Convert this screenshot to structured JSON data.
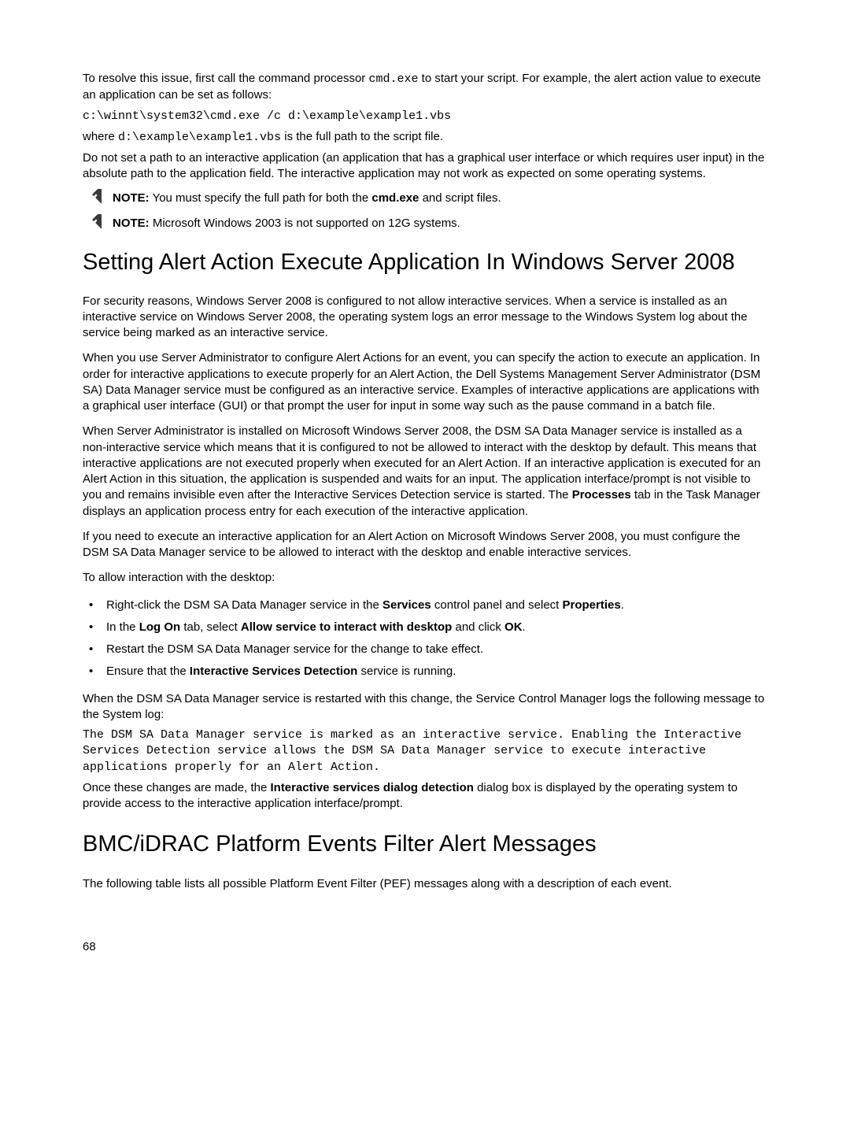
{
  "intro": {
    "p1a": "To resolve this issue, first call the command processor ",
    "p1_cmd": "cmd.exe",
    "p1b": " to start your script. For example, the alert action value to execute an application can be set as follows:",
    "code1": "c:\\winnt\\system32\\cmd.exe /c d:\\example\\example1.vbs",
    "p2a": "where ",
    "p2_code": "d:\\example\\example1.vbs",
    "p2b": " is the full path to the script file.",
    "p3": "Do not set a path to an interactive application (an application that has a graphical user interface or which requires user input) in the absolute path to the application field. The interactive application may not work as expected on some operating systems."
  },
  "note1": {
    "label": "NOTE:",
    "text_a": " You must specify the full path for both the ",
    "bold": "cmd.exe",
    "text_b": " and script files."
  },
  "note2": {
    "label": "NOTE:",
    "text": " Microsoft Windows 2003 is not supported on 12G systems."
  },
  "heading1": "Setting Alert Action Execute Application In Windows Server 2008",
  "section1": {
    "p1": "For security reasons, Windows Server 2008 is configured to not allow interactive services. When a service is installed as an interactive service on Windows Server 2008, the operating system logs an error message to the Windows System log about the service being marked as an interactive service.",
    "p2": "When you use Server Administrator to configure Alert Actions for an event, you can specify the action to execute an application. In order for interactive applications to execute properly for an Alert Action, the Dell Systems Management Server Administrator (DSM SA) Data Manager service must be configured as an interactive service. Examples of interactive applications are applications with a graphical user interface (GUI) or that prompt the user for input in some way such as the pause command in a batch file.",
    "p3a": "When Server Administrator is installed on Microsoft Windows Server 2008, the DSM SA Data Manager service is installed as a non-interactive service which means that it is configured to not be allowed to interact with the desktop by default. This means that interactive applications are not executed properly when executed for an Alert Action. If an interactive application is executed for an Alert Action in this situation, the application is suspended and waits for an input. The application interface/prompt is not visible to you and remains invisible even after the Interactive Services Detection service is started. The ",
    "p3_bold": "Processes",
    "p3b": " tab in the Task Manager displays an application process entry for each execution of the interactive application.",
    "p4": "If you need to execute an interactive application for an Alert Action on Microsoft Windows Server 2008, you must configure the DSM SA Data Manager service to be allowed to interact with the desktop and enable interactive services.",
    "p5": "To allow interaction with the desktop:"
  },
  "bullets": {
    "b1a": "Right-click the DSM SA Data Manager service in the ",
    "b1_bold1": "Services",
    "b1b": " control panel and select ",
    "b1_bold2": "Properties",
    "b1c": ".",
    "b2a": "In the ",
    "b2_bold1": "Log On",
    "b2b": " tab, select ",
    "b2_bold2": "Allow service to interact with desktop",
    "b2c": " and click ",
    "b2_bold3": "OK",
    "b2d": ".",
    "b3": "Restart the DSM SA Data Manager service for the change to take effect.",
    "b4a": "Ensure that the ",
    "b4_bold": "Interactive Services Detection",
    "b4b": " service is running."
  },
  "after_bullets": {
    "p1": "When the DSM SA Data Manager service is restarted with this change, the Service Control Manager logs the following message to the System log:",
    "code": "The DSM SA Data Manager service is marked as an interactive service. Enabling the Interactive Services Detection service allows the DSM SA Data Manager service to execute interactive applications properly for an Alert Action.",
    "p2a": "Once these changes are made, the ",
    "p2_bold": "Interactive services dialog detection",
    "p2b": " dialog box is displayed by the operating system to provide access to the interactive application interface/prompt."
  },
  "heading2": "BMC/iDRAC Platform Events Filter Alert Messages",
  "section2": {
    "p1": "The following table lists all possible Platform Event Filter (PEF) messages along with a description of each event."
  },
  "page_number": "68"
}
